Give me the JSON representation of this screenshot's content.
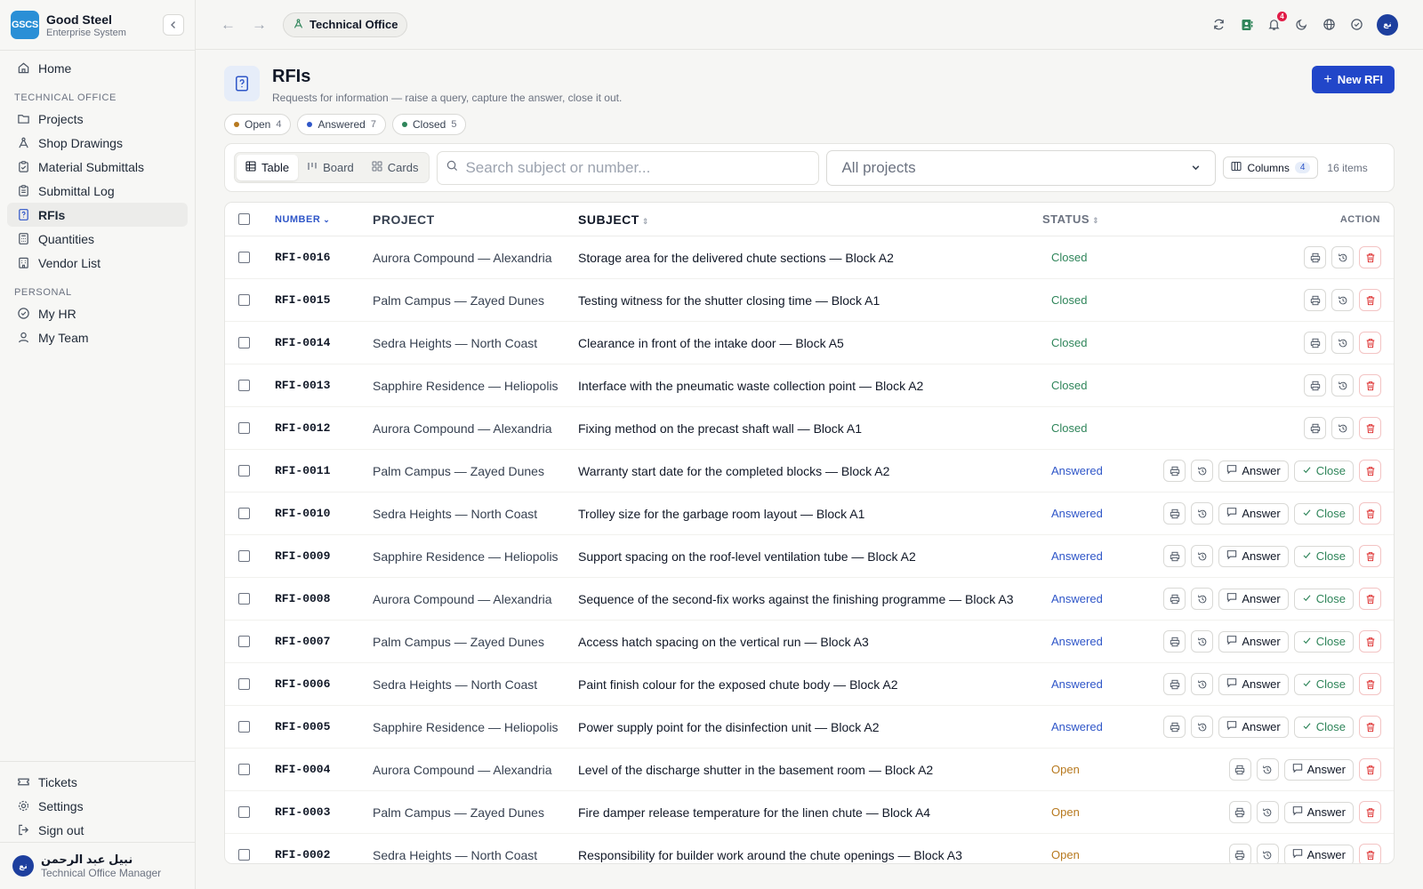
{
  "app": {
    "logo": "GSCS",
    "name": "Good Steel",
    "subtitle": "Enterprise System"
  },
  "sidebar": {
    "home": "Home",
    "section1": "Technical Office",
    "items": [
      "Projects",
      "Shop Drawings",
      "Material Submittals",
      "Submittal Log",
      "RFIs",
      "Quantities",
      "Vendor List"
    ],
    "section2": "Personal",
    "personal": [
      "My HR",
      "My Team"
    ],
    "bottom": [
      "Tickets",
      "Settings",
      "Sign out"
    ],
    "user": {
      "initials": "نع",
      "name": "نبيل عبد الرحمن",
      "role": "Technical Office Manager"
    }
  },
  "topbar": {
    "breadcrumb": "Technical Office",
    "notifications": "4",
    "avatar": "نع"
  },
  "page": {
    "title": "RFIs",
    "subtitle": "Requests for information — raise a query, capture the answer, close it out.",
    "new_button": "New RFI"
  },
  "filters": [
    {
      "label": "Open",
      "count": "4",
      "color": "#b7791f"
    },
    {
      "label": "Answered",
      "count": "7",
      "color": "#2f56c8"
    },
    {
      "label": "Closed",
      "count": "5",
      "color": "#2f855a"
    }
  ],
  "toolbar": {
    "views": [
      "Table",
      "Board",
      "Cards"
    ],
    "search_placeholder": "Search subject or number...",
    "project_select": "All projects",
    "columns_label": "Columns",
    "columns_count": "4",
    "items": "16 items"
  },
  "table": {
    "headers": {
      "number": "NUMBER",
      "project": "PROJECT",
      "subject": "SUBJECT",
      "status": "STATUS",
      "action": "ACTION"
    },
    "actions": {
      "answer": "Answer",
      "close": "Close"
    },
    "rows": [
      {
        "number": "RFI-0016",
        "project": "Aurora Compound — Alexandria",
        "subject": "Storage area for the delivered chute sections — Block A2",
        "status": "Closed"
      },
      {
        "number": "RFI-0015",
        "project": "Palm Campus — Zayed Dunes",
        "subject": "Testing witness for the shutter closing time — Block A1",
        "status": "Closed"
      },
      {
        "number": "RFI-0014",
        "project": "Sedra Heights — North Coast",
        "subject": "Clearance in front of the intake door — Block A5",
        "status": "Closed"
      },
      {
        "number": "RFI-0013",
        "project": "Sapphire Residence — Heliopolis",
        "subject": "Interface with the pneumatic waste collection point — Block A2",
        "status": "Closed"
      },
      {
        "number": "RFI-0012",
        "project": "Aurora Compound — Alexandria",
        "subject": "Fixing method on the precast shaft wall — Block A1",
        "status": "Closed"
      },
      {
        "number": "RFI-0011",
        "project": "Palm Campus — Zayed Dunes",
        "subject": "Warranty start date for the completed blocks — Block A2",
        "status": "Answered"
      },
      {
        "number": "RFI-0010",
        "project": "Sedra Heights — North Coast",
        "subject": "Trolley size for the garbage room layout — Block A1",
        "status": "Answered"
      },
      {
        "number": "RFI-0009",
        "project": "Sapphire Residence — Heliopolis",
        "subject": "Support spacing on the roof-level ventilation tube — Block A2",
        "status": "Answered"
      },
      {
        "number": "RFI-0008",
        "project": "Aurora Compound — Alexandria",
        "subject": "Sequence of the second-fix works against the finishing programme — Block A3",
        "status": "Answered"
      },
      {
        "number": "RFI-0007",
        "project": "Palm Campus — Zayed Dunes",
        "subject": "Access hatch spacing on the vertical run — Block A3",
        "status": "Answered"
      },
      {
        "number": "RFI-0006",
        "project": "Sedra Heights — North Coast",
        "subject": "Paint finish colour for the exposed chute body — Block A2",
        "status": "Answered"
      },
      {
        "number": "RFI-0005",
        "project": "Sapphire Residence — Heliopolis",
        "subject": "Power supply point for the disinfection unit — Block A2",
        "status": "Answered"
      },
      {
        "number": "RFI-0004",
        "project": "Aurora Compound — Alexandria",
        "subject": "Level of the discharge shutter in the basement room — Block A2",
        "status": "Open"
      },
      {
        "number": "RFI-0003",
        "project": "Palm Campus — Zayed Dunes",
        "subject": "Fire damper release temperature for the linen chute — Block A4",
        "status": "Open"
      },
      {
        "number": "RFI-0002",
        "project": "Sedra Heights — North Coast",
        "subject": "Responsibility for builder work around the chute openings — Block A3",
        "status": "Open"
      }
    ]
  }
}
